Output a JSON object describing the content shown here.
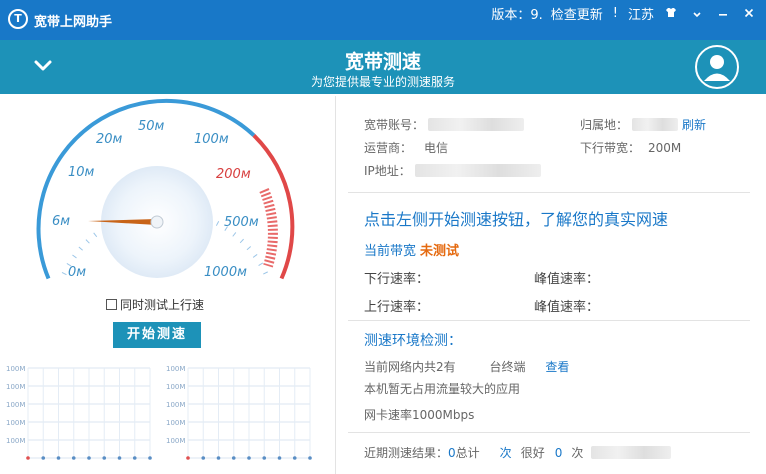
{
  "app": {
    "title": "宽带上网助手",
    "logo_glyph": "T",
    "version_label": "版本：9.",
    "check_update": "检查更新",
    "region": "江苏",
    "tb_sep": "!"
  },
  "header": {
    "title": "宽带测速",
    "subtitle": "为您提供最专业的测速服务"
  },
  "gauge": {
    "ticks": [
      "0м",
      "6м",
      "10м",
      "20м",
      "50м",
      "100м",
      "200м",
      "500м",
      "1000м"
    ],
    "needle_value": "6м"
  },
  "left": {
    "upload_label": "同时测试上行速",
    "start_button": "开始测速"
  },
  "mini_chart": {
    "axis_label": "100M",
    "panel_count": 2
  },
  "account": {
    "account_label": "宽带账号：",
    "region_label": "归属地：",
    "refresh_link": "刷新",
    "isp_label": "运营商：",
    "isp_value": "电信",
    "downlink_label": "下行带宽：",
    "downlink_value": "200M",
    "ip_label": "IP地址："
  },
  "test": {
    "cta": "点击左侧开始测速按钮，了解您的真实网速",
    "current_label": "当前带宽",
    "current_status": "未测试",
    "down_rate": "下行速率：",
    "peak_rate_1": "峰值速率：",
    "up_rate": "上行速率：",
    "peak_rate_2": "峰值速率："
  },
  "env": {
    "title": "测速环境检测：",
    "line1_prefix": "当前网络内共",
    "line1_count": "2",
    "line1_suffix": "有",
    "line1_mid": "台终端",
    "view_link": "查看",
    "line2": "本机暂无占用流量较大的应用",
    "line3": "网卡速率1000Mbps"
  },
  "recent": {
    "label": "近期测速结果：",
    "total_count": "0",
    "total_label": "总计",
    "times1": "次",
    "good_label": "很好",
    "good_count": "0",
    "times2": "次"
  },
  "colors": {
    "titlebar": "#1878c8",
    "header": "#1d92b8",
    "accent": "#1a78c8",
    "status_orange": "#e56a10",
    "gauge_blue": "#3a9ad8",
    "gauge_red": "#e04848"
  }
}
